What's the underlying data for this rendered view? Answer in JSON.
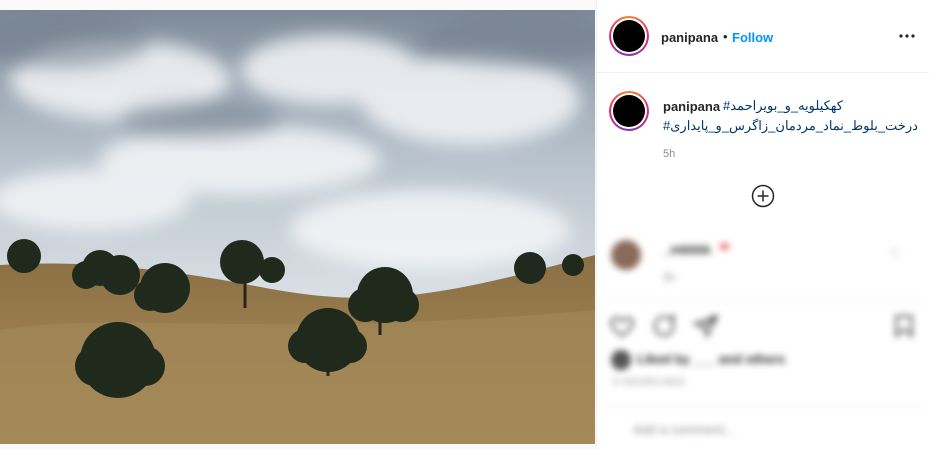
{
  "post": {
    "username": "panipana",
    "separator": "•",
    "follow_label": "Follow",
    "more_icon": "more-dots-icon",
    "caption": {
      "username": "panipana",
      "hashtag_line1": "#کهکیلویه_و_بویراحمد",
      "hashtag_line2": "#درخت_بلوط_نماد_مردمان_زاگرس_و_پایداری",
      "time": "5h"
    },
    "load_more_icon": "plus-circle-icon",
    "comment": {
      "username": "_mkkkk",
      "heart": "❤",
      "time": "5h"
    },
    "likes_text": "Liked by ___ and others",
    "date": "5 HOURS AGO",
    "comment_placeholder": "Add a comment..."
  },
  "colors": {
    "follow": "#0095f6",
    "hashtag": "#00376b",
    "muted": "#8e8e8e"
  }
}
